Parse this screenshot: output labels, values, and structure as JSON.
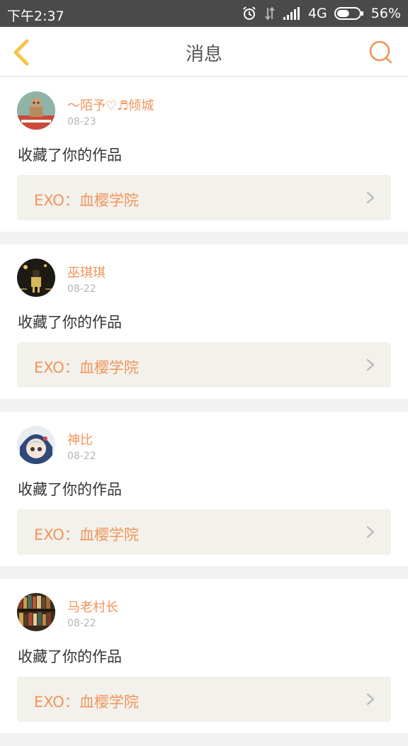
{
  "status_bar": {
    "time": "下午2:37",
    "network": "4G",
    "battery": "56%",
    "battery_level": 0.56
  },
  "nav": {
    "title": "消息"
  },
  "messages": [
    {
      "username": "～陌予♡♬倾城",
      "date": "08-23",
      "action": "收藏了你的作品",
      "work_title": "EXO：血樱学院"
    },
    {
      "username": "巫琪琪",
      "date": "08-22",
      "action": "收藏了你的作品",
      "work_title": "EXO：血樱学院"
    },
    {
      "username": "神比",
      "date": "08-22",
      "action": "收藏了你的作品",
      "work_title": "EXO：血樱学院"
    },
    {
      "username": "马老村长",
      "date": "08-22",
      "action": "收藏了你的作品",
      "work_title": "EXO：血樱学院"
    }
  ],
  "colors": {
    "accent": "#f0945a",
    "back_icon": "#f5c44a",
    "work_bg": "#f3f1eb",
    "page_bg": "#f2f2f2"
  },
  "icons": {
    "back": "chevron-left-icon",
    "search": "search-icon",
    "alarm": "alarm-icon",
    "data": "data-arrows-icon",
    "signal": "signal-icon",
    "battery": "battery-icon",
    "arrow": "chevron-right-icon"
  }
}
